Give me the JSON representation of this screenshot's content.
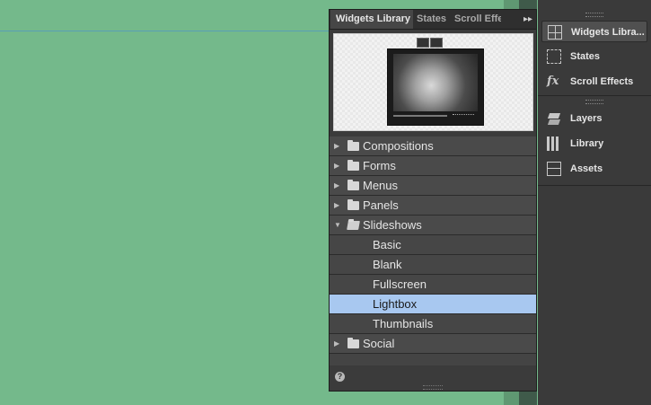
{
  "widgets_panel": {
    "tabs": [
      {
        "label": "Widgets Library",
        "active": true
      },
      {
        "label": "States",
        "active": false
      },
      {
        "label": "Scroll Effe",
        "active": false
      }
    ],
    "menu_glyph": "▸▸",
    "help_glyph": "?",
    "items": [
      {
        "label": "Compositions",
        "type": "folder",
        "expanded": false
      },
      {
        "label": "Forms",
        "type": "folder",
        "expanded": false
      },
      {
        "label": "Menus",
        "type": "folder",
        "expanded": false
      },
      {
        "label": "Panels",
        "type": "folder",
        "expanded": false
      },
      {
        "label": "Slideshows",
        "type": "folder",
        "expanded": true
      },
      {
        "label": "Basic",
        "type": "child"
      },
      {
        "label": "Blank",
        "type": "child"
      },
      {
        "label": "Fullscreen",
        "type": "child"
      },
      {
        "label": "Lightbox",
        "type": "child",
        "selected": true
      },
      {
        "label": "Thumbnails",
        "type": "child"
      },
      {
        "label": "Social",
        "type": "folder",
        "expanded": false
      }
    ]
  },
  "dock": {
    "group1": [
      {
        "label": "Widgets Libra...",
        "icon": "widgets-library-icon",
        "active": true
      },
      {
        "label": "States",
        "icon": "states-icon",
        "active": false
      },
      {
        "label": "Scroll Effects",
        "icon": "fx-icon",
        "active": false
      }
    ],
    "group2": [
      {
        "label": "Layers",
        "icon": "layers-icon",
        "active": false
      },
      {
        "label": "Library",
        "icon": "library-icon",
        "active": false
      },
      {
        "label": "Assets",
        "icon": "assets-icon",
        "active": false
      }
    ]
  },
  "colors": {
    "canvas": "#74b98b",
    "selected_row": "#a8c8f0",
    "panel_bg": "#3b3b3b"
  }
}
